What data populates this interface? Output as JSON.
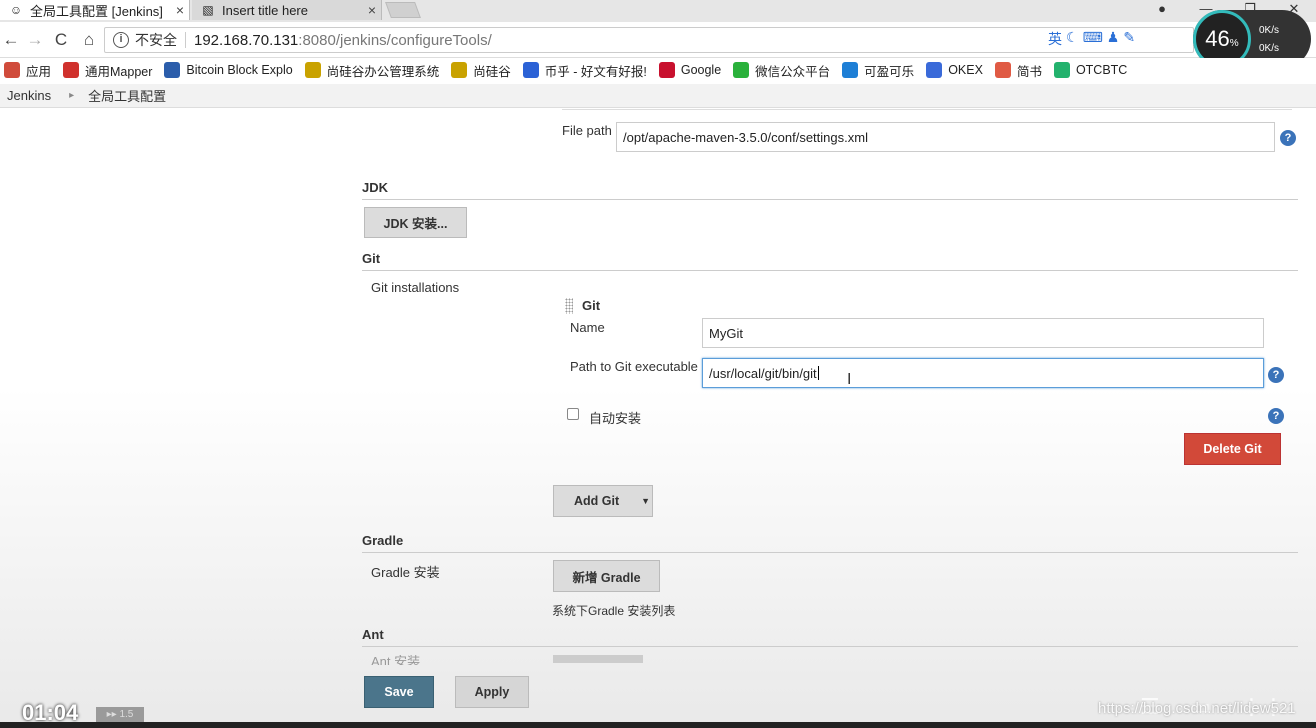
{
  "browser": {
    "tabs": [
      {
        "label": "全局工具配置 [Jenkins]",
        "close": "×",
        "active": true
      },
      {
        "label": "Insert title here",
        "close": "×",
        "active": false
      }
    ],
    "nav": {
      "back": "←",
      "forward": "→",
      "reload": "C",
      "home": "⌂"
    },
    "address": {
      "insecure_label": "不安全",
      "host": "192.168.70.131",
      "rest": ":8080/jenkins/configureTools/"
    },
    "extensions": [
      "英"
    ],
    "speed_widget": {
      "percent": "46",
      "percent_unit": "%",
      "up_rate": "0K/s",
      "down_rate": "0K/s"
    },
    "bookmarks": [
      {
        "label": "应用",
        "color": "#d04b3b"
      },
      {
        "label": "通用Mapper",
        "color": "#d0312d"
      },
      {
        "label": "Bitcoin Block Explo",
        "color": "#2b5dab"
      },
      {
        "label": "尚硅谷办公管理系统",
        "color": "#c9a200"
      },
      {
        "label": "尚硅谷",
        "color": "#c9a200"
      },
      {
        "label": "币乎 - 好文有好报!",
        "color": "#2b62d6"
      },
      {
        "label": "Google",
        "color": "#c8102e"
      },
      {
        "label": "微信公众平台",
        "color": "#2ab13b"
      },
      {
        "label": "可盈可乐",
        "color": "#1e7fd6"
      },
      {
        "label": "OKEX",
        "color": "#3a6ad9"
      },
      {
        "label": "简书",
        "color": "#e05a44"
      },
      {
        "label": "OTCBTC",
        "color": "#23b26d"
      }
    ]
  },
  "breadcrumb": {
    "root": "Jenkins",
    "current": "全局工具配置"
  },
  "maven_settings": {
    "file_path_label": "File path",
    "file_path_value": "/opt/apache-maven-3.5.0/conf/settings.xml"
  },
  "jdk": {
    "title": "JDK",
    "install_button": "JDK 安装..."
  },
  "git": {
    "title": "Git",
    "installations_label": "Git installations",
    "entry_title": "Git",
    "name_label": "Name",
    "name_value": "MyGit",
    "path_label": "Path to Git executable",
    "path_value": "/usr/local/git/bin/git",
    "auto_install_label": "自动安装",
    "delete_button": "Delete Git",
    "add_button": "Add Git"
  },
  "gradle": {
    "title": "Gradle",
    "install_label": "Gradle 安装",
    "add_button": "新增 Gradle",
    "list_caption": "系统下Gradle 安装列表"
  },
  "ant": {
    "title": "Ant",
    "install_label": "Ant 安装"
  },
  "actions": {
    "save": "Save",
    "apply": "Apply"
  },
  "help_glyph": "?",
  "video": {
    "timestamp": "01:04",
    "speed": "▸▸ 1.5",
    "watermark": "https://blog.csdn.net/lidew521"
  }
}
